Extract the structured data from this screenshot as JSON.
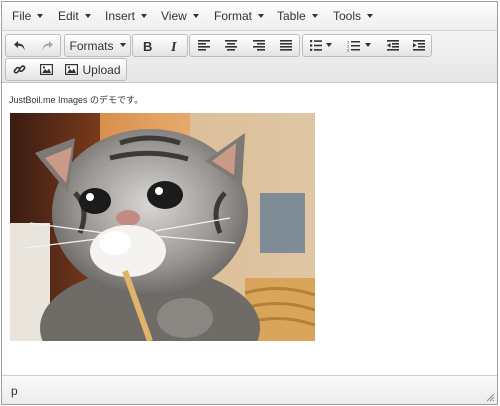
{
  "menubar": {
    "items": [
      "File",
      "Edit",
      "Insert",
      "View",
      "Format",
      "Table",
      "Tools"
    ]
  },
  "toolbar": {
    "formats_label": "Formats",
    "upload_label": "Upload",
    "icons": [
      "undo-icon",
      "redo-icon",
      "bold-icon",
      "italic-icon",
      "align-left-icon",
      "align-center-icon",
      "align-right-icon",
      "align-justify-icon",
      "bullet-list-icon",
      "numbered-list-icon",
      "outdent-icon",
      "indent-icon",
      "link-icon",
      "image-icon",
      "upload-image-icon"
    ]
  },
  "content": {
    "demo_text": "JustBoil.me Images のデモです。",
    "image_subject": "kitten-photo"
  },
  "statusbar": {
    "path": "p"
  },
  "colors": {
    "menubar_bg": "#f4f4f4",
    "border": "#9e9e9e",
    "icon": "#333333",
    "redo_disabled": "#a8a8a8"
  }
}
